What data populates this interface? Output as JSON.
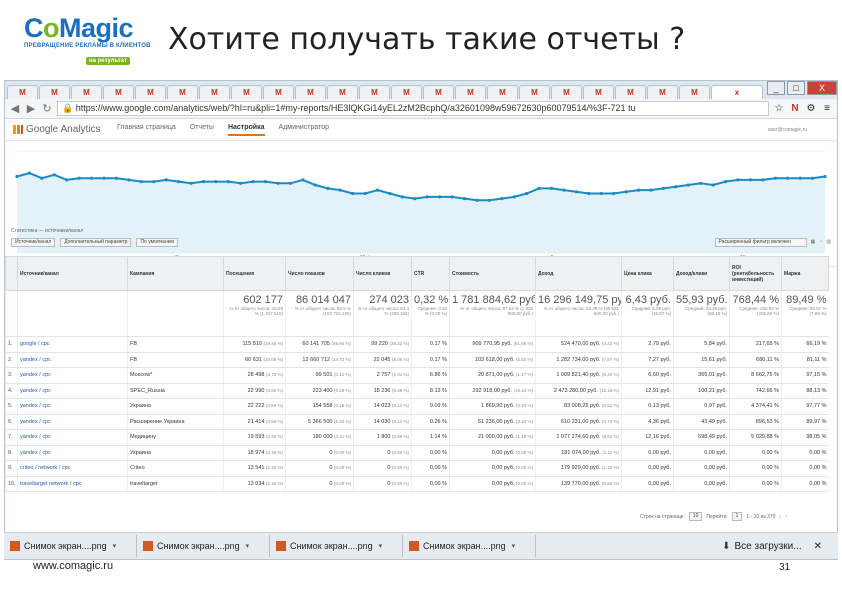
{
  "slide": {
    "logo_text_a": "C",
    "logo_text_b": "o",
    "logo_text_c": "Magic",
    "logo_tagline": "ПРЕВРАЩЕНИЕ РЕКЛАМЫ В КЛИЕНТОВ",
    "logo_badge": "на результат",
    "title": "Хотите получать такие отчеты ?",
    "footer_url": "www.comagic.ru",
    "page_number": "31"
  },
  "browser": {
    "tabs": [
      "M",
      "M",
      "M",
      "M",
      "M",
      "M",
      "M",
      "M",
      "M",
      "M",
      "M",
      "M",
      "M",
      "M",
      "M",
      "M",
      "M",
      "M",
      "M",
      "M",
      "M",
      "M",
      "x"
    ],
    "url": "https://www.google.com/analytics/web/?hl=ru&pli=1#my-reports/HE3lQKGi14yEL2zM2BcphQ/a32601098w59672630p60079514/%3F-721 tu",
    "window_controls": [
      "_",
      "□",
      "X"
    ]
  },
  "ga": {
    "brand": "Google Analytics",
    "nav": [
      "Главная страница",
      "Отчеты",
      "Настройка",
      "Администратор"
    ],
    "active_nav_index": 2,
    "user": "user@comagic.ru",
    "section_label": "Статистика — источники/канал",
    "controls": {
      "dim1": "Источник/канал",
      "dim2": "Дополнительный параметр",
      "filter_label": "По умолчанию",
      "search_placeholder": "Расширенный фильтр включен"
    },
    "axis_labels": [
      "Январь",
      "15 февр.",
      "Февраль",
      "15 марта",
      "Март",
      "1 апреля"
    ]
  },
  "table": {
    "headers": [
      "",
      "Источник/канал",
      "Кампания",
      "Посещения",
      "Число показов",
      "Число кликов",
      "CTR",
      "Стоимость",
      "Доход",
      "Цена клика",
      "Доход/клики",
      "ROI (рентабельность инвестиций)",
      "Маржа"
    ],
    "totals": {
      "visits": "602 177",
      "visits_sub": "% от общего числа: 15.55 % (1 317 510)",
      "impressions": "86 014 047",
      "impressions_sub": "% от общего числа: 82.5 % (103 724 190)",
      "clicks": "274 023",
      "clicks_sub": "% от общего числа: 83.4 % (329 160)",
      "ctr": "0,32 %",
      "ctr_sub": "Среднее: 0.32 % (0.00 %)",
      "cost": "1 781 884,62 руб.",
      "cost_sub": "% от общего числа: 97.54 % (1 826 900.00 руб.)",
      "revenue": "16 296 149,75 руб.",
      "revenue_sub": "% от общего числа: 53.39 % (30 521 600.00 руб.)",
      "cpc": "6,43 руб.",
      "cpc_sub": "Средний: 5.55 руб. (15.87 %)",
      "rpc": "55,93 руб.",
      "rpc_sub": "Средний: 33.26 руб. (68.16 %)",
      "roi": "768,44 %",
      "roi_sub": "Среднее: 250.60 % (206.60 %)",
      "margin": "89,49 %",
      "margin_sub": "Среднее: 82.87 % (7.99 %)"
    },
    "rows": [
      {
        "idx": "1.",
        "source": "google / cpc",
        "campaign": "FB",
        "visits": "115 810",
        "visits_pct": "(19.40 %)",
        "impr": "60 141 705",
        "impr_pct": "(69.94 %)",
        "clicks": "99 220",
        "clicks_pct": "(36.22 %)",
        "ctr": "0.17 %",
        "cost": "909 770,95 руб.",
        "cost_pct": "(51.06 %)",
        "rev": "524 470,00 руб.",
        "rev_pct": "(3.22 %)",
        "cpc": "2,79 руб.",
        "rpc": "5,84 руб.",
        "roi": "217,65 %",
        "margin": "66,19 %"
      },
      {
        "idx": "2.",
        "source": "yandex / cpc",
        "campaign": "FB",
        "visits": "60 631",
        "visits_pct": "(10.09 %)",
        "impr": "12 660 712",
        "impr_pct": "(14.72 %)",
        "clicks": "22 045",
        "clicks_pct": "(8.05 %)",
        "ctr": "0.17 %",
        "cost": "103 618,00 руб.",
        "cost_pct": "(5.82 %)",
        "rev": "1 282 734,00 руб.",
        "rev_pct": "(7.87 %)",
        "cpc": "7,27 руб.",
        "rpc": "15,61 руб.",
        "roi": "680,11 %",
        "margin": "81,11 %"
      },
      {
        "idx": "3.",
        "source": "yandex / cpc",
        "campaign": "Moscow*",
        "visits": "28 498",
        "visits_pct": "(4.73 %)",
        "impr": "99 501",
        "impr_pct": "(0.12 %)",
        "clicks": "2 757",
        "clicks_pct": "(1.01 %)",
        "ctr": "6.86 %",
        "cost": "20 871,00 руб.",
        "cost_pct": "(1.17 %)",
        "rev": "1 009 821,40 руб.",
        "rev_pct": "(6.20 %)",
        "cpc": "6,60 руб.",
        "rpc": "365,01 руб.",
        "roi": "8 662,75 %",
        "margin": "97,15 %"
      },
      {
        "idx": "4.",
        "source": "yandex / cpc",
        "campaign": "SPEC_Russia",
        "visits": "22 990",
        "visits_pct": "(3.82 %)",
        "impr": "223 400",
        "impr_pct": "(0.26 %)",
        "clicks": "18 236",
        "clicks_pct": "(6.65 %)",
        "ctr": "8.13 %",
        "cost": "292 918,00 руб.",
        "cost_pct": "(16.44 %)",
        "rev": "2 473 280,00 руб.",
        "rev_pct": "(15.18 %)",
        "cpc": "12,91 руб.",
        "rpc": "100,21 руб.",
        "roi": "742,66 %",
        "margin": "88,13 %"
      },
      {
        "idx": "5.",
        "source": "yandex / cpc",
        "campaign": "Украина",
        "visits": "22 222",
        "visits_pct": "(3.69 %)",
        "impr": "154 558",
        "impr_pct": "(0.18 %)",
        "clicks": "14 023",
        "clicks_pct": "(5.12 %)",
        "ctr": "9.09 %",
        "cost": "1 869,90 руб.",
        "cost_pct": "(0.10 %)",
        "rev": "83 008,25 руб.",
        "rev_pct": "(0.51 %)",
        "cpc": "0,13 руб.",
        "rpc": "0,97 руб.",
        "roi": "4 374,41 %",
        "margin": "97,77 %"
      },
      {
        "idx": "6.",
        "source": "yandex / cpc",
        "campaign": "Расширение Украина",
        "visits": "21 414",
        "visits_pct": "(3.56 %)",
        "impr": "5 366 500",
        "impr_pct": "(6.24 %)",
        "clicks": "14 030",
        "clicks_pct": "(5.12 %)",
        "ctr": "0.26 %",
        "cost": "61 236,00 руб.",
        "cost_pct": "(3.44 %)",
        "rev": "610 231,00 руб.",
        "rev_pct": "(3.74 %)",
        "cpc": "4,36 руб.",
        "rpc": "43,49 руб.",
        "roi": "896,53 %",
        "margin": "89,97 %"
      },
      {
        "idx": "7.",
        "source": "yandex / cpc",
        "campaign": "Медицину",
        "visits": "19 593",
        "visits_pct": "(3.25 %)",
        "impr": "180 000",
        "impr_pct": "(0.21 %)",
        "clicks": "1 800",
        "clicks_pct": "(0.66 %)",
        "ctr": "1.14 %",
        "cost": "21 000,00 руб.",
        "cost_pct": "(1.18 %)",
        "rev": "1 077 274,60 руб.",
        "rev_pct": "(6.61 %)",
        "cpc": "12,16 руб.",
        "rpc": "598,49 руб.",
        "roi": "5 029,88 %",
        "margin": "98,05 %"
      },
      {
        "idx": "8.",
        "source": "yandex / cpc",
        "campaign": "Украина",
        "visits": "18 974",
        "visits_pct": "(3.15 %)",
        "impr": "0",
        "impr_pct": "(0.00 %)",
        "clicks": "0",
        "clicks_pct": "(0.00 %)",
        "ctr": "0,00 %",
        "cost": "0,00 руб.",
        "cost_pct": "(0.00 %)",
        "rev": "181 074,00 руб.",
        "rev_pct": "(1.11 %)",
        "cpc": "0,00 руб.",
        "rpc": "0,00 руб.",
        "roi": "0,00 %",
        "margin": "0,00 %"
      },
      {
        "idx": "9.",
        "source": "criteo / network / cpc",
        "campaign": "Criteo",
        "visits": "13 541",
        "visits_pct": "(2.25 %)",
        "impr": "0",
        "impr_pct": "(0.00 %)",
        "clicks": "0",
        "clicks_pct": "(0.00 %)",
        "ctr": "0,00 %",
        "cost": "0,00 руб.",
        "cost_pct": "(0.00 %)",
        "rev": "179 929,00 руб.",
        "rev_pct": "(1.10 %)",
        "cpc": "0,00 руб.",
        "rpc": "0,00 руб.",
        "roi": "0,00 %",
        "margin": "0,00 %"
      },
      {
        "idx": "10.",
        "source": "traveltarget network / cpc",
        "campaign": "traveltarget",
        "visits": "13 034",
        "visits_pct": "(2.16 %)",
        "impr": "0",
        "impr_pct": "(0.00 %)",
        "clicks": "0",
        "clicks_pct": "(0.00 %)",
        "ctr": "0,00 %",
        "cost": "0,00 руб.",
        "cost_pct": "(0.00 %)",
        "rev": "139 770,00 руб.",
        "rev_pct": "(0.86 %)",
        "cpc": "0,00 руб.",
        "rpc": "0,00 руб.",
        "roi": "0,00 %",
        "margin": "0,00 %"
      }
    ],
    "pager": {
      "rows_label": "Строк на странице:",
      "rows_value": "10",
      "goto": "Перейти:",
      "page": "1",
      "range": "1 - 10 из 370"
    }
  },
  "downloads": {
    "items": [
      "Снимок экран....png",
      "Снимок экран....png",
      "Снимок экран....png",
      "Снимок экран....png"
    ],
    "all_label": "Все загрузки..."
  },
  "chart_data": {
    "type": "line",
    "series": [
      {
        "values": [
          45,
          47,
          44,
          46,
          43,
          44,
          44,
          44,
          44,
          43,
          42,
          42,
          43,
          42,
          41,
          42,
          42,
          42,
          41,
          42,
          42,
          41,
          41,
          43,
          40,
          38,
          37,
          35,
          35,
          37,
          35,
          33,
          32,
          33,
          33,
          33,
          32,
          31,
          31,
          32,
          33,
          35,
          38,
          38,
          37,
          36,
          35,
          35,
          35,
          36,
          37,
          37,
          38,
          39,
          40,
          41,
          40,
          42,
          43,
          43,
          43,
          44,
          44,
          44,
          44,
          45
        ]
      }
    ],
    "ylim": [
      0,
      60
    ],
    "xlabels": [
      "Январь",
      "15 февр.",
      "Февраль",
      "15 марта",
      "Март",
      "1 апреля"
    ],
    "color": "#1a8cc3",
    "fill": "#e3f1f9",
    "grid": true
  },
  "colors": {
    "accent": "#e8711a",
    "link": "#2a57a8",
    "chart": "#1a8cc3"
  }
}
